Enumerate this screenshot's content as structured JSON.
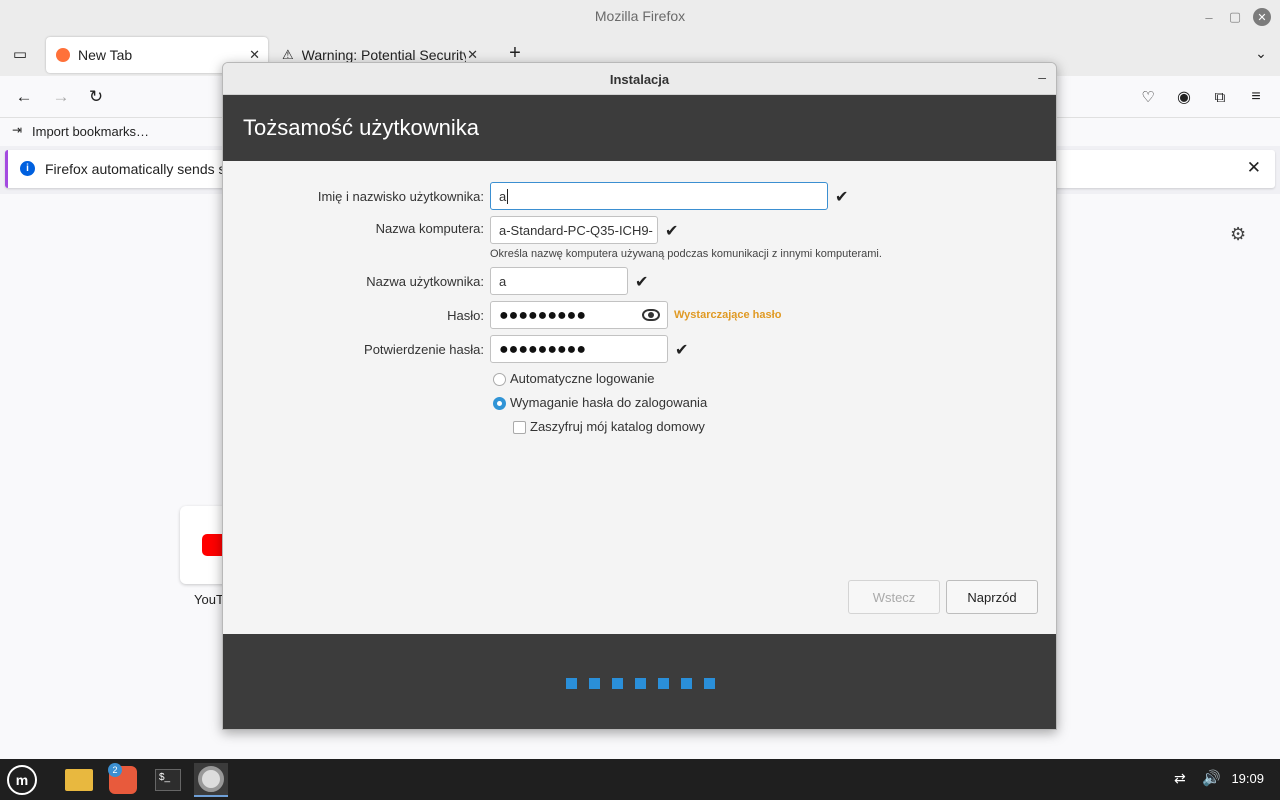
{
  "firefox": {
    "window_title": "Mozilla Firefox",
    "tabs": [
      {
        "label": "New Tab"
      },
      {
        "label": "Warning: Potential Security"
      }
    ],
    "bookmarks_label": "Import bookmarks…",
    "notice_text": "Firefox automatically sends so",
    "shortcut_label": "YouT"
  },
  "installer": {
    "window_title": "Instalacja",
    "heading": "Tożsamość użytkownika",
    "fields": {
      "fullname_label": "Imię i nazwisko użytkownika:",
      "fullname_value": "a",
      "computer_label": "Nazwa komputera:",
      "computer_value": "a-Standard-PC-Q35-ICH9-",
      "computer_hint": "Określa nazwę komputera używaną podczas komunikacji z innymi komputerami.",
      "username_label": "Nazwa użytkownika:",
      "username_value": "a",
      "password_label": "Hasło:",
      "password_value": "●●●●●●●●●",
      "password_strength": "Wystarczające hasło",
      "confirm_label": "Potwierdzenie hasła:",
      "confirm_value": "●●●●●●●●●"
    },
    "options": {
      "auto_login": "Automatyczne logowanie",
      "require_password": "Wymaganie hasła do zalogowania",
      "encrypt_home": "Zaszyfruj mój katalog domowy",
      "selected": "require_password",
      "encrypt_checked": false
    },
    "buttons": {
      "back": "Wstecz",
      "next": "Naprzód"
    },
    "progress_steps": 7,
    "accent_color": "#2a8fd9",
    "strength_color": "#e09a24"
  },
  "taskbar": {
    "badge_count": "2",
    "clock": "19:09"
  }
}
